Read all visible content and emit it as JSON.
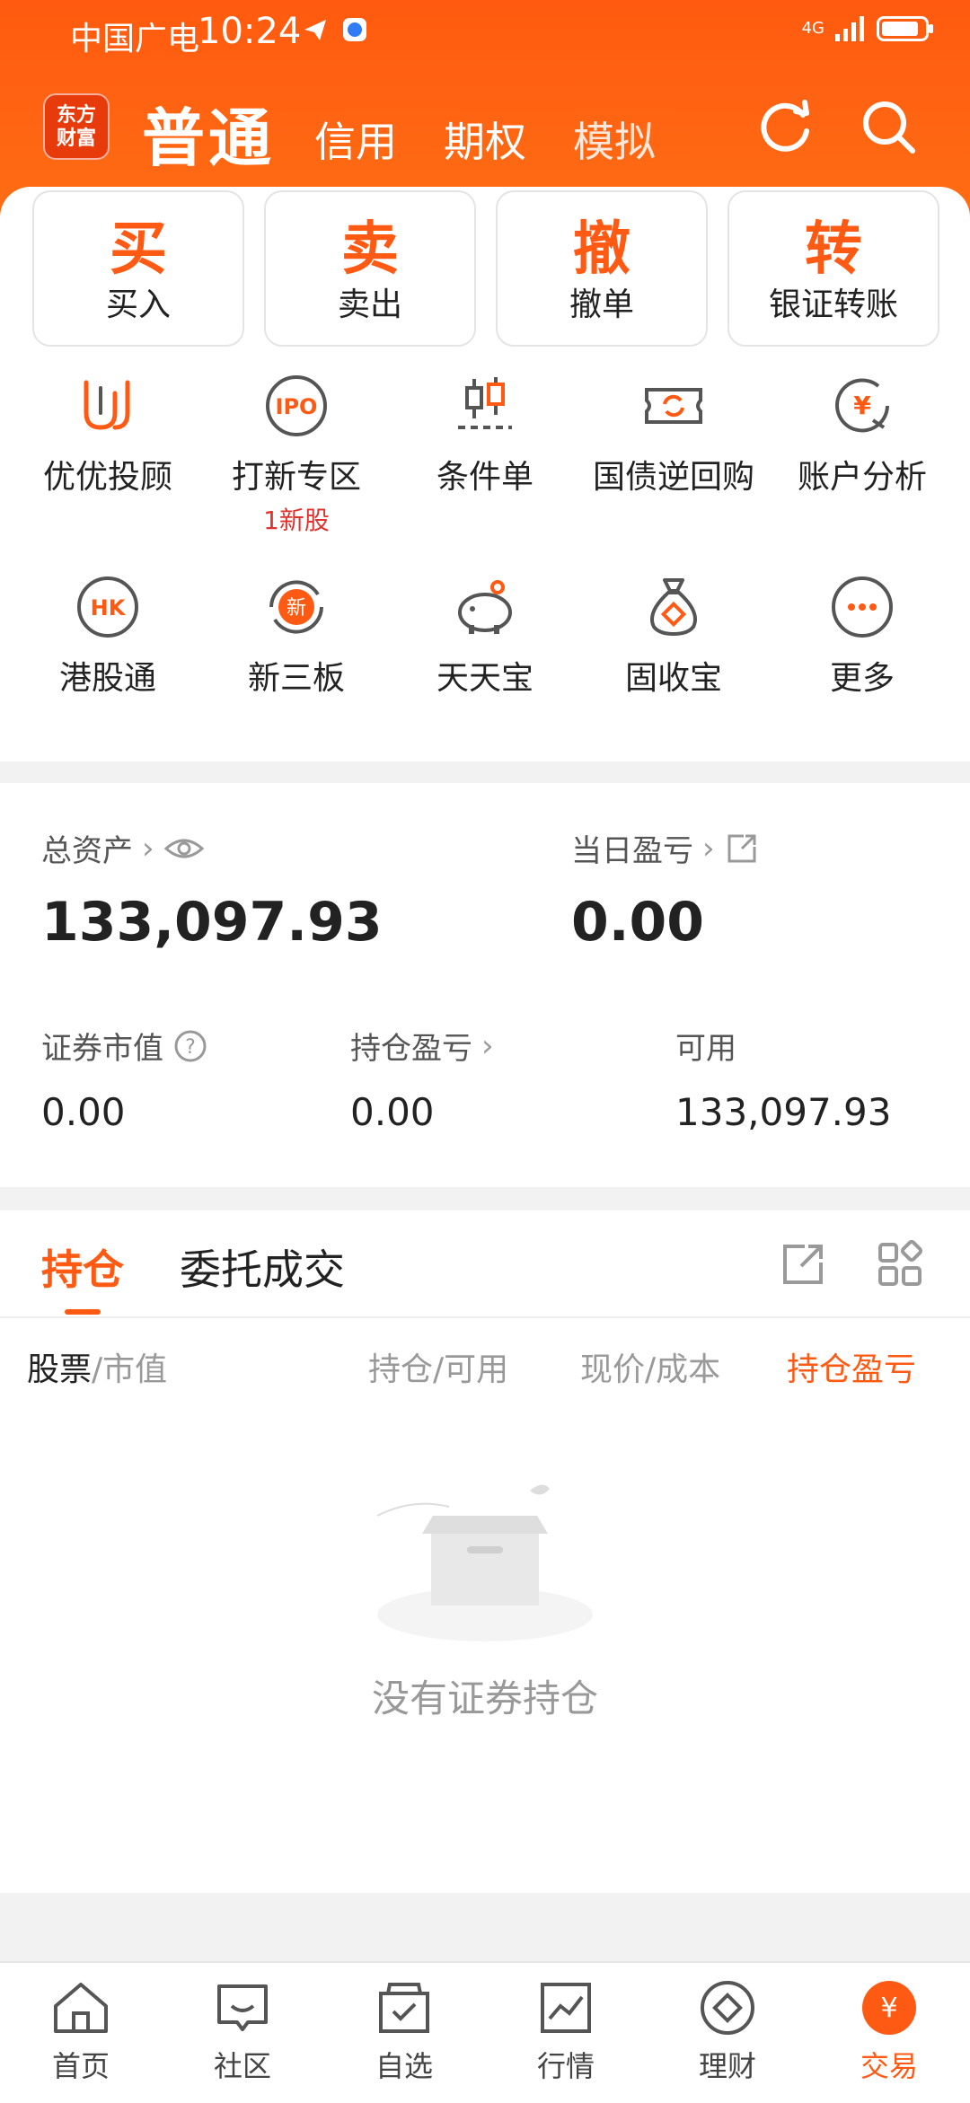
{
  "status": {
    "carrier": "中国广电",
    "time": "10:24",
    "network": "4G"
  },
  "nav": {
    "logo": [
      "东方",
      "财富"
    ],
    "tabs": [
      "普通",
      "信用",
      "期权",
      "模拟"
    ]
  },
  "quick_actions": [
    {
      "big": "买",
      "small": "买入"
    },
    {
      "big": "卖",
      "small": "卖出"
    },
    {
      "big": "撤",
      "small": "撤单"
    },
    {
      "big": "转",
      "small": "银证转账"
    }
  ],
  "services": [
    {
      "label": "优优投顾",
      "icon": "youyou-icon"
    },
    {
      "label": "打新专区",
      "icon": "ipo-icon",
      "sub": "1新股"
    },
    {
      "label": "条件单",
      "icon": "candlestick-icon"
    },
    {
      "label": "国债逆回购",
      "icon": "bond-repo-icon"
    },
    {
      "label": "账户分析",
      "icon": "account-analysis-icon"
    },
    {
      "label": "港股通",
      "icon": "hk-icon"
    },
    {
      "label": "新三板",
      "icon": "new-board-icon"
    },
    {
      "label": "天天宝",
      "icon": "piggy-bank-icon"
    },
    {
      "label": "固收宝",
      "icon": "money-bag-icon"
    },
    {
      "label": "更多",
      "icon": "more-icon"
    }
  ],
  "assets": {
    "total_label": "总资产",
    "total_value": "133,097.93",
    "daily_pl_label": "当日盈亏",
    "daily_pl_value": "0.00",
    "market_value_label": "证券市值",
    "market_value": "0.00",
    "holding_pl_label": "持仓盈亏",
    "holding_pl": "0.00",
    "available_label": "可用",
    "available": "133,097.93"
  },
  "positions": {
    "tab_active": "持仓",
    "tab_other": "委托成交",
    "col_stock": "股票",
    "col_stock_sub": "/市值",
    "col_hold": "持仓/可用",
    "col_price": "现价/成本",
    "col_pl": "持仓盈亏",
    "empty": "没有证券持仓"
  },
  "bottom_nav": [
    {
      "label": "首页",
      "icon": "home-icon"
    },
    {
      "label": "社区",
      "icon": "community-icon"
    },
    {
      "label": "自选",
      "icon": "watchlist-icon"
    },
    {
      "label": "行情",
      "icon": "market-icon"
    },
    {
      "label": "理财",
      "icon": "wealth-icon"
    },
    {
      "label": "交易",
      "icon": "trade-icon",
      "active": true
    }
  ],
  "colors": {
    "accent": "#ff5a14",
    "red": "#e0332e"
  }
}
